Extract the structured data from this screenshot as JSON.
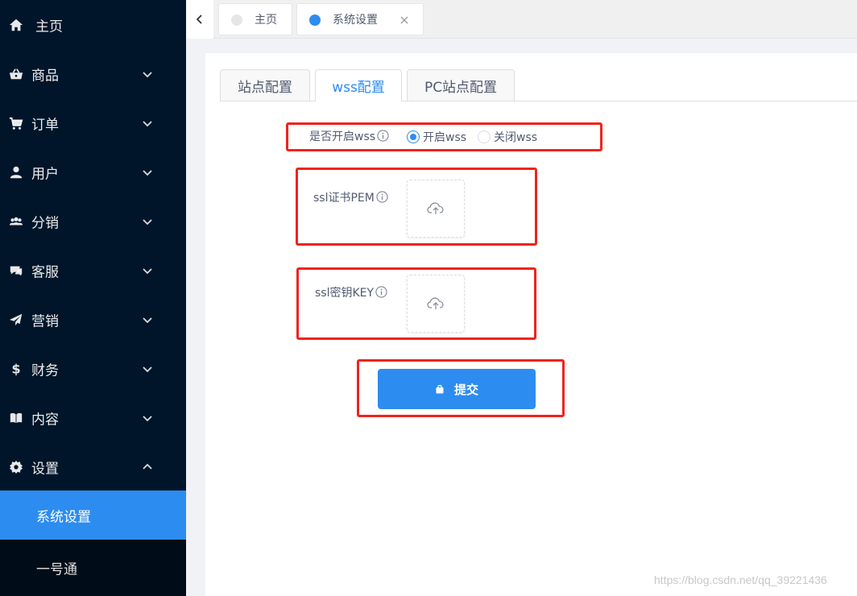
{
  "sidebar": {
    "items": [
      {
        "label": "主页",
        "icon": "home-icon"
      },
      {
        "label": "商品",
        "icon": "shopping-basket-icon"
      },
      {
        "label": "订单",
        "icon": "cart-icon"
      },
      {
        "label": "用户",
        "icon": "user-icon"
      },
      {
        "label": "分销",
        "icon": "people-icon"
      },
      {
        "label": "客服",
        "icon": "chat-icon"
      },
      {
        "label": "营销",
        "icon": "paper-plane-icon"
      },
      {
        "label": "财务",
        "icon": "dollar-icon"
      },
      {
        "label": "内容",
        "icon": "book-icon"
      },
      {
        "label": "设置",
        "icon": "gear-icon"
      }
    ],
    "subitems": [
      {
        "label": "系统设置",
        "active": true
      },
      {
        "label": "一号通",
        "active": false
      }
    ],
    "active_color": "#2d8cf0",
    "background": "#001529"
  },
  "tabs": [
    {
      "label": "主页"
    },
    {
      "label": "系统设置"
    }
  ],
  "config_tabs": [
    {
      "label": "站点配置"
    },
    {
      "label": "wss配置"
    },
    {
      "label": "PC站点配置"
    }
  ],
  "form": {
    "wss_label": "是否开启wss",
    "radio_on": "开启wss",
    "radio_off": "关闭wss",
    "pem_label": "ssl证书PEM",
    "key_label": "ssl密钥KEY",
    "submit_label": "提交"
  },
  "watermark": "https://blog.csdn.net/qq_39221436",
  "colors": {
    "accent": "#2d8cf0",
    "highlight": "#f0231e"
  }
}
